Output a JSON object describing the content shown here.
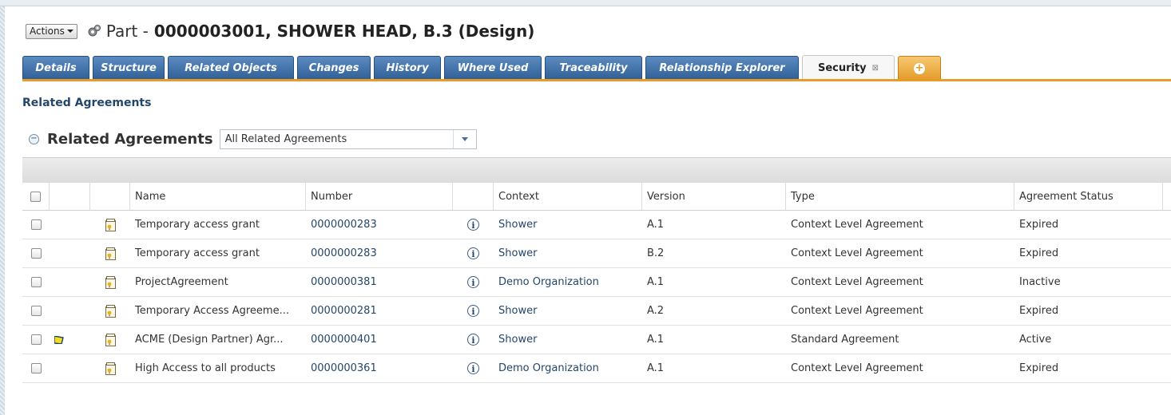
{
  "header": {
    "actions_label": "Actions",
    "object_type": "Part -",
    "object_title": "0000003001, SHOWER HEAD, B.3 (Design)"
  },
  "tabs": [
    {
      "label": "Details"
    },
    {
      "label": "Structure"
    },
    {
      "label": "Related Objects"
    },
    {
      "label": "Changes"
    },
    {
      "label": "History"
    },
    {
      "label": "Where Used"
    },
    {
      "label": "Traceability"
    },
    {
      "label": "Relationship Explorer"
    },
    {
      "label": "Security",
      "active": true
    }
  ],
  "section_title": "Related Agreements",
  "table": {
    "title": "Related Agreements",
    "filter_value": "All Related Agreements",
    "columns": [
      "Name",
      "Number",
      "Context",
      "Version",
      "Type",
      "Agreement Status"
    ],
    "rows": [
      {
        "name": "Temporary access grant",
        "number": "0000000283",
        "context": "Shower",
        "version": "A.1",
        "type": "Context Level Agreement",
        "status": "Expired",
        "flag": false
      },
      {
        "name": "Temporary access grant",
        "number": "0000000283",
        "context": "Shower",
        "version": "B.2",
        "type": "Context Level Agreement",
        "status": "Expired",
        "flag": false
      },
      {
        "name": "ProjectAgreement",
        "number": "0000000381",
        "context": "Demo Organization",
        "version": "A.1",
        "type": "Context Level Agreement",
        "status": "Inactive",
        "flag": false
      },
      {
        "name": "Temporary Access Agreeme...",
        "number": "0000000281",
        "context": "Shower",
        "version": "A.2",
        "type": "Context Level Agreement",
        "status": "Expired",
        "flag": false
      },
      {
        "name": "ACME (Design Partner) Agr...",
        "number": "0000000401",
        "context": "Shower",
        "version": "A.1",
        "type": "Standard Agreement",
        "status": "Active",
        "flag": true
      },
      {
        "name": "High Access to all products",
        "number": "0000000361",
        "context": "Demo Organization",
        "version": "A.1",
        "type": "Context Level Agreement",
        "status": "Expired",
        "flag": false
      }
    ]
  },
  "colors": {
    "tab_blue": "#2f5f94",
    "tab_accent": "#e89a2b",
    "link": "#23466b"
  },
  "icons": {
    "actions_caret": "chevron-down-icon",
    "part": "gears-icon",
    "tab_close": "close-icon",
    "add_tab": "plus-icon",
    "collapse": "collapse-icon",
    "row_type": "agreement-doc-icon",
    "info": "info-icon",
    "flag": "flag-icon"
  }
}
